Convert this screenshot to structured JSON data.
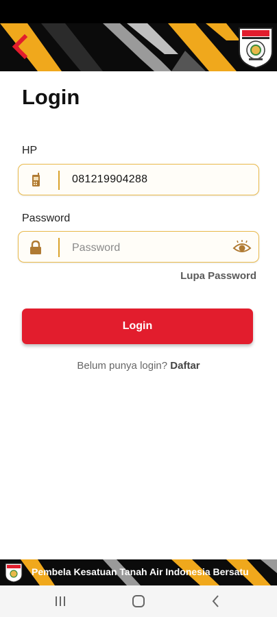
{
  "colors": {
    "accent_red": "#e21d2d",
    "gold": "#e9b94a",
    "header_black": "#0b0b0b",
    "stripe_gold": "#f0a81c",
    "stripe_gray": "#9a9a9a"
  },
  "header": {
    "back_icon": "chevron-left-icon",
    "logo": "organization-logo-shield"
  },
  "page": {
    "title": "Login"
  },
  "form": {
    "phone": {
      "label": "HP",
      "icon": "mobile-phone-icon",
      "value": "081219904288"
    },
    "password": {
      "label": "Password",
      "icon": "padlock-icon",
      "placeholder": "Password",
      "toggle_icon": "eye-icon"
    },
    "forgot_label": "Lupa Password",
    "submit_label": "Login",
    "register_prompt": "Belum punya login?",
    "register_link": "Daftar"
  },
  "footer": {
    "slogan": "Pembela Kesatuan Tanah Air Indonesia Bersatu"
  },
  "navbar": {
    "recent_icon": "recent-apps-icon",
    "home_icon": "home-icon",
    "back_icon": "back-icon"
  }
}
